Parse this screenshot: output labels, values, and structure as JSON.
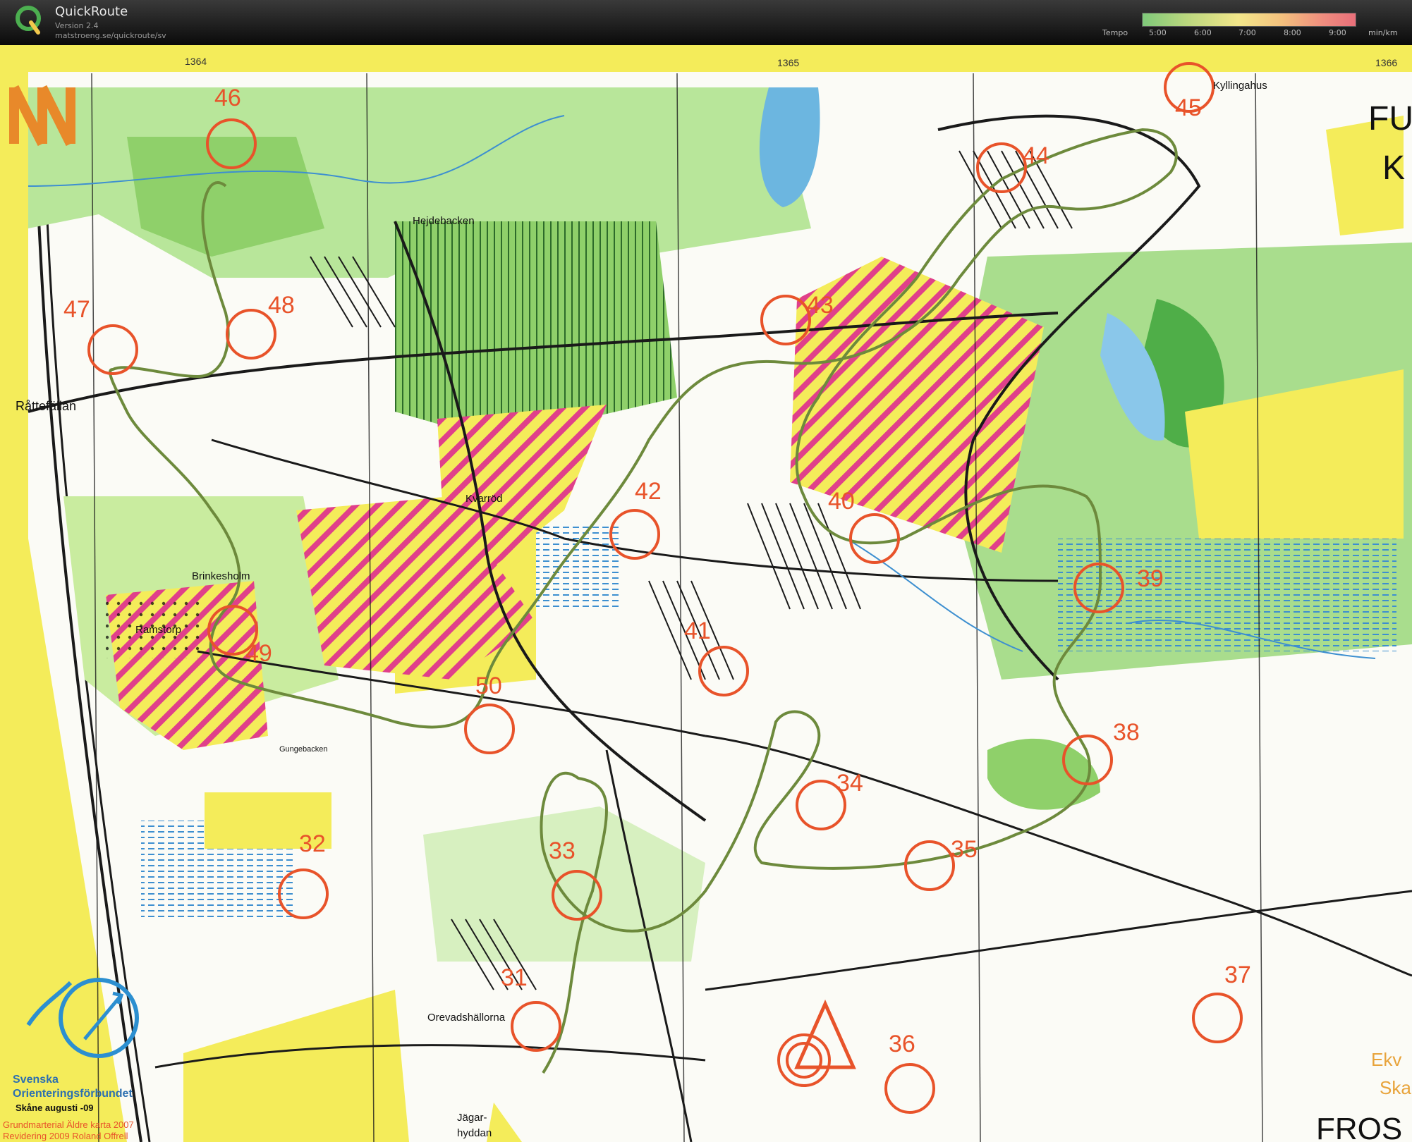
{
  "app": {
    "title": "QuickRoute",
    "version": "Version 2.4",
    "url": "matstroeng.se/quickroute/sv"
  },
  "tempo": {
    "label": "Tempo",
    "ticks": [
      "5:00",
      "6:00",
      "7:00",
      "8:00",
      "9:00"
    ],
    "unit": "min/km"
  },
  "map": {
    "grid_labels": [
      "1364",
      "1365",
      "1366"
    ],
    "place_names": [
      "Kyllingahus",
      "Hejdebacken",
      "Råttefällan",
      "Kvarröd",
      "Brinkesholm",
      "Ramstorp",
      "Gungebacken",
      "Orevadshällorna",
      "Jägar-",
      "hyddan",
      "Ekv",
      "Ska",
      "FROS",
      "FU",
      "K"
    ],
    "controls": [
      "31",
      "32",
      "33",
      "34",
      "35",
      "36",
      "37",
      "38",
      "39",
      "40",
      "41",
      "42",
      "43",
      "44",
      "45",
      "46",
      "47",
      "48",
      "49",
      "50"
    ],
    "federation": {
      "line1": "Svenska",
      "line2": "Orienteringsförbundet",
      "line3": "Skåne  augusti -09"
    },
    "credits": {
      "line1": "Grundmarterial Äldre karta 2007",
      "line2": "Revidering 2009  Roland Offrell"
    },
    "north_letter": "N"
  },
  "colors": {
    "forest_green": "#8fd06a",
    "dark_green": "#4fae48",
    "open_yellow": "#f4ec5a",
    "water_blue": "#6cb6e0",
    "forbidden_magenta": "#e0408a",
    "control_red": "#e8532a",
    "route_olive": "#6d8a3c"
  }
}
